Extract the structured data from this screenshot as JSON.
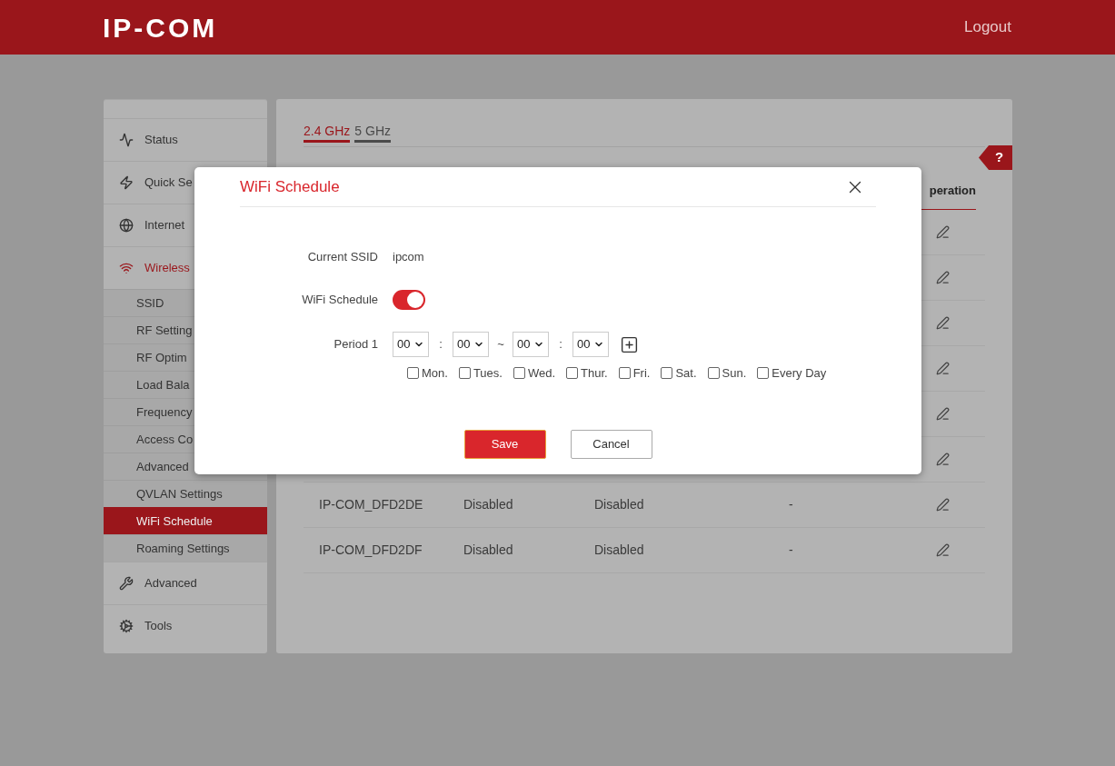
{
  "header": {
    "logo": "IP-COM",
    "logout": "Logout"
  },
  "sidebar": {
    "items": [
      {
        "label": "Status",
        "active": false
      },
      {
        "label": "Quick Se",
        "active": false
      },
      {
        "label": "Internet",
        "active": false
      },
      {
        "label": "Wireless",
        "active": true,
        "children": [
          {
            "label": "SSID",
            "selected": false
          },
          {
            "label": "RF Setting",
            "selected": false
          },
          {
            "label": "RF Optim",
            "selected": false
          },
          {
            "label": "Load Bala",
            "selected": false
          },
          {
            "label": "Frequency",
            "selected": false
          },
          {
            "label": "Access Co",
            "selected": false
          },
          {
            "label": "Advanced",
            "selected": false
          },
          {
            "label": "QVLAN Settings",
            "selected": false
          },
          {
            "label": "WiFi Schedule",
            "selected": true
          },
          {
            "label": "Roaming Settings",
            "selected": false
          }
        ]
      },
      {
        "label": "Advanced",
        "active": false
      },
      {
        "label": "Tools",
        "active": false
      }
    ]
  },
  "tabs": [
    {
      "label": "2.4 GHz",
      "selected": true
    },
    {
      "label": "5 GHz",
      "selected": false
    }
  ],
  "help": "?",
  "table": {
    "column_5": "peration",
    "rows": [
      {
        "cells": [
          "IP-COM_DFD2DE",
          "Disabled",
          "Disabled",
          "-"
        ]
      },
      {
        "cells": [
          "IP-COM_DFD2DF",
          "Disabled",
          "Disabled",
          "-"
        ]
      }
    ]
  },
  "dialog": {
    "title": "WiFi Schedule",
    "ssid_label": "Current SSID",
    "ssid_value": "ipcom",
    "schedule_label": "WiFi Schedule",
    "schedule_on": true,
    "period_label": "Period 1",
    "times": [
      {
        "value": "00",
        "sep": ":"
      },
      {
        "value": "00",
        "sep": "~"
      },
      {
        "value": "00",
        "sep": ":"
      },
      {
        "value": "00"
      }
    ],
    "days": [
      {
        "label": "Mon.",
        "checked": false
      },
      {
        "label": "Tues.",
        "checked": false
      },
      {
        "label": "Wed.",
        "checked": false
      },
      {
        "label": "Thur.",
        "checked": false
      },
      {
        "label": "Fri.",
        "checked": false
      },
      {
        "label": "Sat.",
        "checked": false
      },
      {
        "label": "Sun.",
        "checked": false
      },
      {
        "label": "Every Day",
        "checked": false
      }
    ],
    "save": "Save",
    "cancel": "Cancel"
  }
}
